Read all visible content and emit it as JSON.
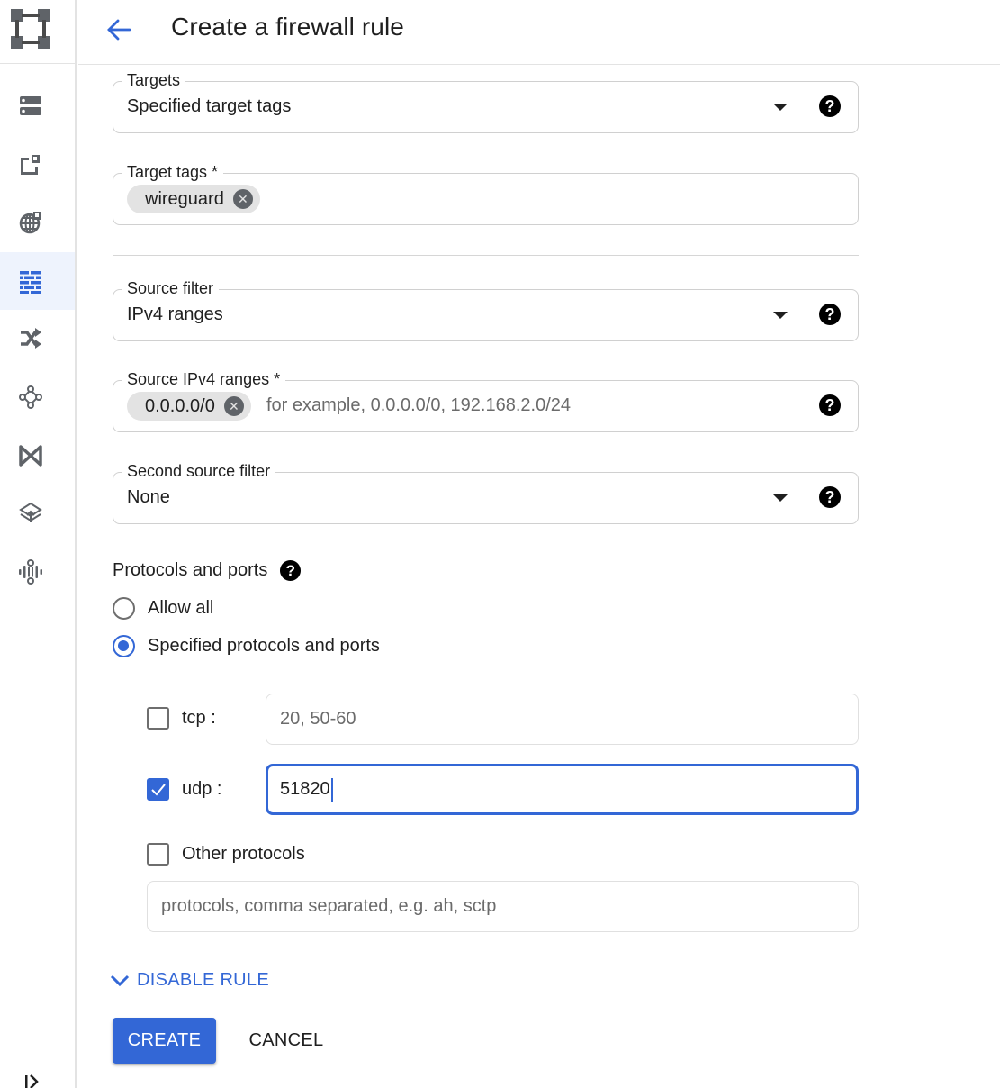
{
  "header": {
    "title": "Create a firewall rule",
    "back_icon": "arrow-back-icon"
  },
  "sidebar": {
    "logo_icon": "vpc-network-logo-icon",
    "items": [
      {
        "icon": "server-icon",
        "active": false
      },
      {
        "icon": "external-ip-icon",
        "active": false
      },
      {
        "icon": "globe-network-icon",
        "active": false
      },
      {
        "icon": "firewall-icon",
        "active": true
      },
      {
        "icon": "routes-icon",
        "active": false
      },
      {
        "icon": "network-topology-icon",
        "active": false
      },
      {
        "icon": "vpc-peering-icon",
        "active": false
      },
      {
        "icon": "shared-vpc-icon",
        "active": false
      },
      {
        "icon": "packet-mirroring-icon",
        "active": false
      }
    ],
    "expand_icon": "expand-sidebar-icon"
  },
  "colors": {
    "accent": "#3367d6",
    "active_nav_bg": "#eef3fd",
    "chip_bg": "#e3e3e3"
  },
  "form": {
    "targets": {
      "label": "Targets",
      "value": "Specified target tags"
    },
    "target_tags": {
      "label": "Target tags *",
      "chips": [
        "wireguard"
      ]
    },
    "source_filter": {
      "label": "Source filter",
      "value": "IPv4 ranges"
    },
    "source_ipv4_ranges": {
      "label": "Source IPv4 ranges *",
      "chips": [
        "0.0.0.0/0"
      ],
      "placeholder": "for example, 0.0.0.0/0, 192.168.2.0/24"
    },
    "second_source_filter": {
      "label": "Second source filter",
      "value": "None"
    },
    "protocols": {
      "heading": "Protocols and ports",
      "radios": [
        {
          "label": "Allow all",
          "checked": false
        },
        {
          "label": "Specified protocols and ports",
          "checked": true
        }
      ],
      "tcp": {
        "label": "tcp :",
        "checked": false,
        "value": "",
        "placeholder": "20, 50-60"
      },
      "udp": {
        "label": "udp :",
        "checked": true,
        "value": "51820",
        "placeholder": ""
      },
      "other": {
        "label": "Other protocols",
        "checked": false,
        "value": "",
        "placeholder": "protocols, comma separated, e.g. ah, sctp"
      }
    },
    "disable_rule_label": "DISABLE RULE",
    "create_label": "CREATE",
    "cancel_label": "CANCEL"
  }
}
